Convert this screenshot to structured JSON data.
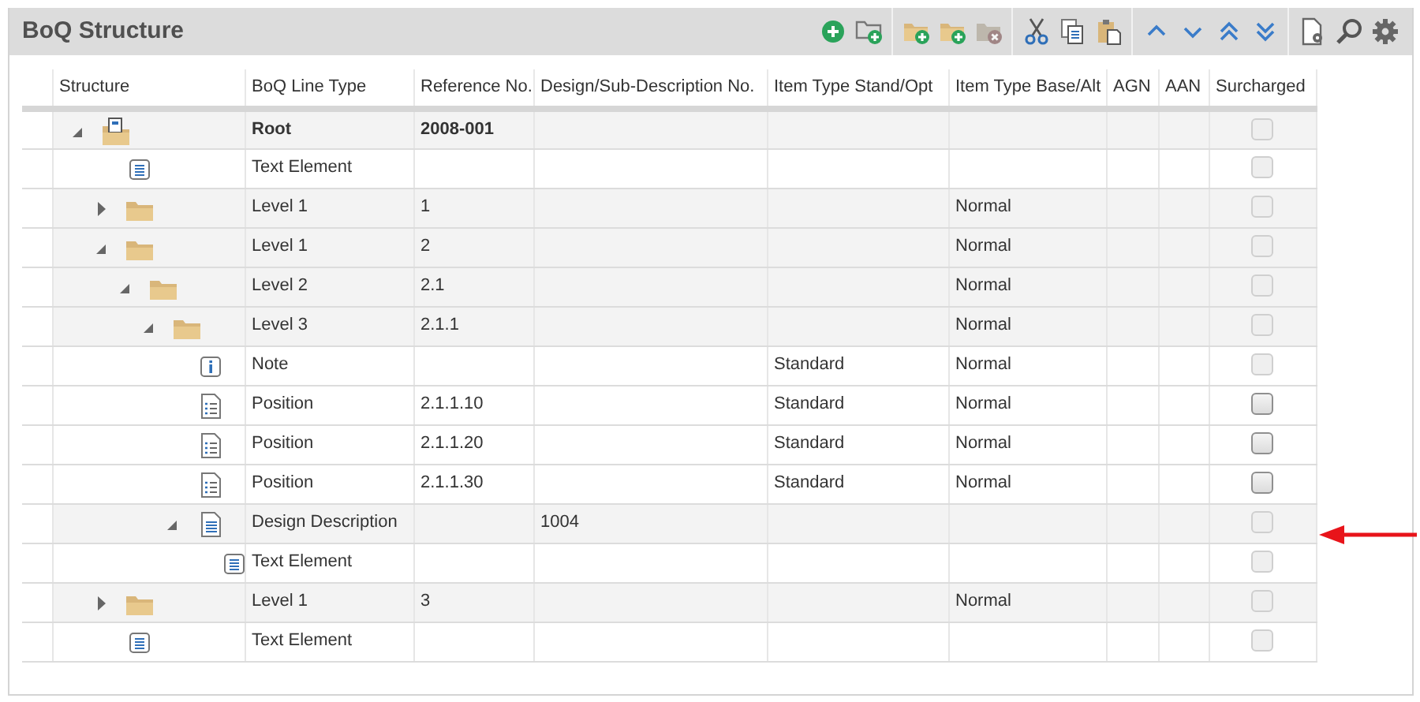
{
  "panel": {
    "title": "BoQ Structure"
  },
  "toolbar": [
    {
      "disabled": false
    },
    {
      "disabled": false
    },
    {
      "disabled": false
    },
    {
      "disabled": false
    },
    {
      "disabled": true
    },
    {
      "disabled": false
    },
    {
      "disabled": false
    },
    {
      "disabled": false
    },
    {
      "disabled": false
    },
    {
      "disabled": false
    },
    {
      "disabled": false
    },
    {
      "disabled": false
    },
    {
      "disabled": false
    },
    {
      "disabled": false
    },
    {
      "disabled": false
    }
  ],
  "table": {
    "columns": [
      "Structure",
      "BoQ Line Type",
      "Reference No.",
      "Design/Sub-Description No.",
      "Item Type Stand/Opt",
      "Item Type Base/Alt",
      "AGN",
      "AAN",
      "Surcharged"
    ],
    "rows": [
      {
        "kind": "root",
        "expanded": true,
        "line_type": "Root",
        "reference": "2008-001",
        "surcharged": {
          "checked": false,
          "disabled": true
        },
        "children": [
          {
            "kind": "text",
            "line_type": "Text Element",
            "surcharged": {
              "checked": false,
              "disabled": true
            }
          },
          {
            "kind": "folder",
            "expanded": false,
            "line_type": "Level 1",
            "reference": "1",
            "base_alt": "Normal",
            "surcharged": {
              "checked": false,
              "disabled": true
            }
          },
          {
            "kind": "folder",
            "expanded": true,
            "line_type": "Level 1",
            "reference": "2",
            "base_alt": "Normal",
            "surcharged": {
              "checked": false,
              "disabled": true
            },
            "children": [
              {
                "kind": "folder",
                "expanded": true,
                "line_type": "Level 2",
                "reference": "2.1",
                "base_alt": "Normal",
                "surcharged": {
                  "checked": false,
                  "disabled": true
                },
                "children": [
                  {
                    "kind": "folder",
                    "expanded": true,
                    "line_type": "Level 3",
                    "reference": "2.1.1",
                    "base_alt": "Normal",
                    "surcharged": {
                      "checked": false,
                      "disabled": true
                    },
                    "children": [
                      {
                        "kind": "note",
                        "line_type": "Note",
                        "stand_opt": "Standard",
                        "base_alt": "Normal",
                        "surcharged": {
                          "checked": false,
                          "disabled": true
                        }
                      },
                      {
                        "kind": "position",
                        "line_type": "Position",
                        "reference": "2.1.1.10",
                        "stand_opt": "Standard",
                        "base_alt": "Normal",
                        "surcharged": {
                          "checked": false,
                          "disabled": false
                        }
                      },
                      {
                        "kind": "position",
                        "line_type": "Position",
                        "reference": "2.1.1.20",
                        "stand_opt": "Standard",
                        "base_alt": "Normal",
                        "surcharged": {
                          "checked": false,
                          "disabled": false
                        }
                      },
                      {
                        "kind": "position",
                        "line_type": "Position",
                        "reference": "2.1.1.30",
                        "stand_opt": "Standard",
                        "base_alt": "Normal",
                        "surcharged": {
                          "checked": false,
                          "disabled": false
                        }
                      },
                      {
                        "kind": "design",
                        "expanded": true,
                        "line_type": "Design Description",
                        "description_no": "1004",
                        "surcharged": {
                          "checked": false,
                          "disabled": true
                        },
                        "children": [
                          {
                            "kind": "text",
                            "line_type": "Text Element",
                            "surcharged": {
                              "checked": false,
                              "disabled": true
                            }
                          }
                        ]
                      }
                    ]
                  }
                ]
              }
            ]
          },
          {
            "kind": "folder",
            "expanded": false,
            "line_type": "Level 1",
            "reference": "3",
            "base_alt": "Normal",
            "surcharged": {
              "checked": false,
              "disabled": true
            }
          },
          {
            "kind": "text",
            "line_type": "Text Element",
            "surcharged": {
              "checked": false,
              "disabled": true
            }
          }
        ]
      }
    ]
  }
}
